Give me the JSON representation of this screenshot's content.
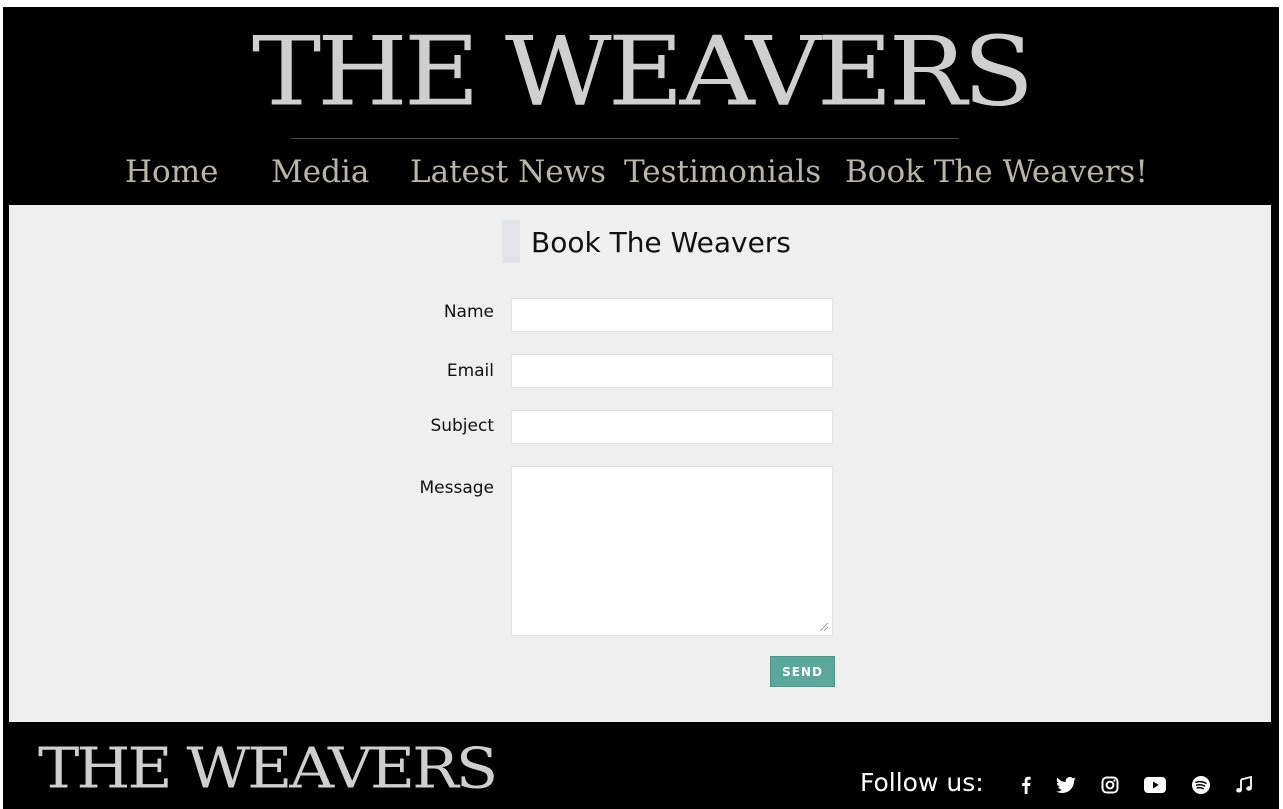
{
  "header": {
    "logo_text": "THE WEAVERS",
    "nav": [
      {
        "label": "Home"
      },
      {
        "label": "Media"
      },
      {
        "label": "Latest News"
      },
      {
        "label": "Testimonials"
      },
      {
        "label": "Book The Weavers!"
      }
    ]
  },
  "form": {
    "title": "Book The Weavers",
    "name_label": "Name",
    "email_label": "Email",
    "subject_label": "Subject",
    "message_label": "Message",
    "name_value": "",
    "email_value": "",
    "subject_value": "",
    "message_value": "",
    "send_label": "SEND"
  },
  "footer": {
    "logo_text": "THE WEAVERS",
    "follow_label": "Follow us:",
    "social_icons": [
      "facebook-icon",
      "twitter-icon",
      "instagram-icon",
      "youtube-icon",
      "spotify-icon",
      "music-note-icon"
    ]
  },
  "colors": {
    "background": "#000000",
    "content": "#efefef",
    "logo": "#cfcfcf",
    "nav_text": "#b9b5a8",
    "send_button": "#5aa89b"
  }
}
